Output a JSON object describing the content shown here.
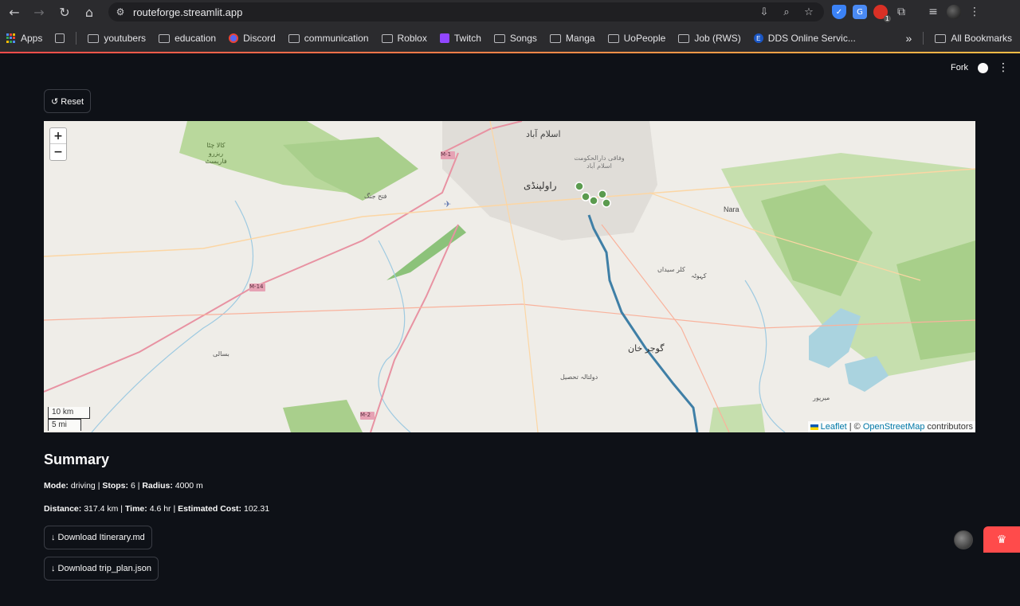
{
  "browser": {
    "url": "routeforge.streamlit.app",
    "nav": {
      "back": "←",
      "forward": "→",
      "reload": "↻",
      "home": "⌂"
    },
    "bookmarks": [
      {
        "label": "Apps",
        "icon": "apps-grid-icon"
      },
      {
        "label": "youtubers",
        "icon": "folder-icon"
      },
      {
        "label": "education",
        "icon": "folder-icon"
      },
      {
        "label": "Discord",
        "icon": "discord-icon"
      },
      {
        "label": "communication",
        "icon": "folder-icon"
      },
      {
        "label": "Roblox",
        "icon": "folder-icon"
      },
      {
        "label": "Twitch",
        "icon": "twitch-icon"
      },
      {
        "label": "Songs",
        "icon": "folder-icon"
      },
      {
        "label": "Manga",
        "icon": "folder-icon"
      },
      {
        "label": "UoPeople",
        "icon": "folder-icon"
      },
      {
        "label": "Job (RWS)",
        "icon": "folder-icon"
      },
      {
        "label": "DDS Online Servic...",
        "icon": "dds-icon"
      }
    ],
    "more_bookmarks": "»",
    "all_bookmarks": "All Bookmarks",
    "extension_badge": "1"
  },
  "app": {
    "header": {
      "fork_label": "Fork",
      "menu": "⋮"
    },
    "reset_button": "↺ Reset",
    "map": {
      "zoom_in": "+",
      "zoom_out": "−",
      "scale_km": "10 km",
      "scale_mi": "5 mi",
      "attribution_leaflet": "Leaflet",
      "attribution_sep": " | © ",
      "attribution_osm": "OpenStreetMap",
      "attribution_tail": " contributors",
      "labels": {
        "islamabad": "اسلام آباد",
        "rawalpindi": "راولپنڈی",
        "gujar_khan": "گوجر خان",
        "m1": "M-1",
        "m14": "M-14",
        "m2": "M-2",
        "nara": "Nara",
        "kala_chitta": "کالا چٹا ریزرو فاریسٹ",
        "wafaqi": "وفاقی دارالحکومت اسلام آباد",
        "fateh_jang": "فتح جنگ",
        "kallar": "کلر سیداں",
        "daultala": "دولتالہ تحصیل",
        "mirpur": "میرپور",
        "kahuta": "کہوٹہ",
        "basali": "بسالی"
      }
    },
    "summary": {
      "title": "Summary",
      "mode_label": "Mode:",
      "mode_value": "driving",
      "stops_label": "Stops:",
      "stops_value": "6",
      "radius_label": "Radius:",
      "radius_value": "4000 m",
      "distance_label": "Distance:",
      "distance_value": "317.4 km",
      "time_label": "Time:",
      "time_value": "4.6 hr",
      "cost_label": "Estimated Cost:",
      "cost_value": "102.31",
      "sep": " | "
    },
    "download_itinerary": "↓ Download Itinerary.md",
    "download_json": "↓ Download trip_plan.json"
  }
}
